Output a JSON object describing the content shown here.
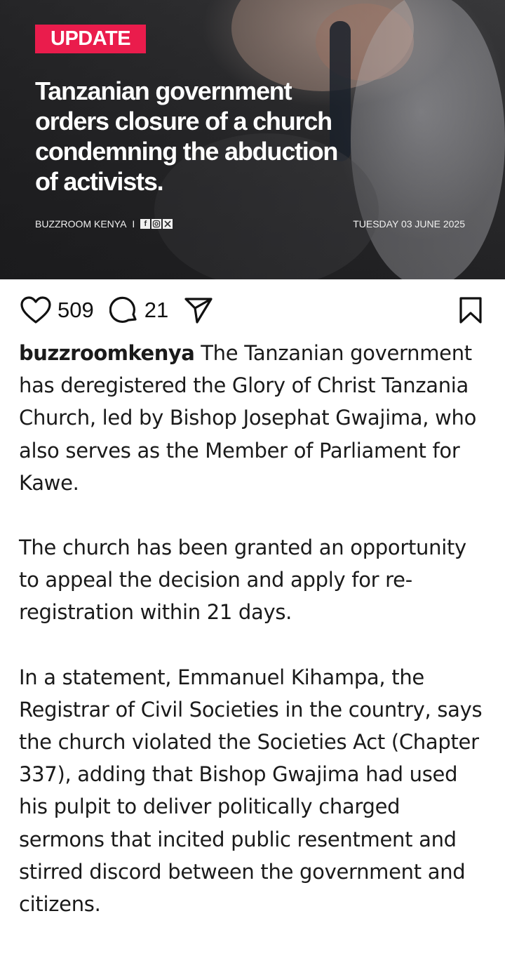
{
  "hero": {
    "badge": "UPDATE",
    "headline": "Tanzanian government orders closure of a church condemning the abduction of activists.",
    "source": "BUZZROOM KENYA",
    "separator": "I",
    "social_icons": [
      "facebook-icon",
      "instagram-icon",
      "x-icon"
    ],
    "date": "TUESDAY 03 JUNE 2025",
    "badge_color": "#ea1c4c"
  },
  "actions": {
    "likes": "509",
    "comments": "21"
  },
  "caption": {
    "username": "buzzroomkenya",
    "paragraphs": [
      "The Tanzanian government has deregistered the Glory of Christ Tanzania Church, led by Bishop Josephat Gwajima, who also serves as the Member of Parliament for Kawe.",
      "The church has been granted an opportunity to appeal the decision and apply for re-registration within 21 days.",
      "In a statement, Emmanuel Kihampa, the Registrar of Civil Societies in the country, says the church violated the Societies Act (Chapter 337), adding that Bishop Gwajima had used his pulpit to deliver politically charged sermons that incited public resentment and stirred discord between the government and citizens."
    ]
  }
}
